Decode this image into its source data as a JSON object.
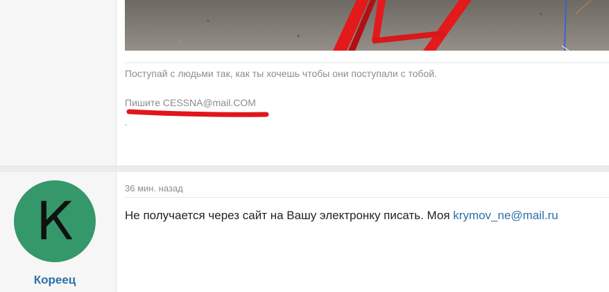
{
  "post_previous": {
    "signature_text": "Поступай с людьми так, как ты хочешь чтобы они поступали с тобой.",
    "contact_text": "Пишите CESSNA@mail.COM",
    "trailing_text": "."
  },
  "post_current": {
    "author": {
      "avatar_letter": "К",
      "avatar_color": "#35986a",
      "name": "Кореец"
    },
    "timestamp": "36 мин. назад",
    "body_text": "Не получается через сайт на Вашу электронку писать. Моя ",
    "body_link": "krymov_ne@mail.ru"
  },
  "colors": {
    "link": "#2b6fa8",
    "muted_text": "#8c8c8c",
    "annotation_red": "#e0161b",
    "sidebar_bg": "#f6f6f6"
  }
}
